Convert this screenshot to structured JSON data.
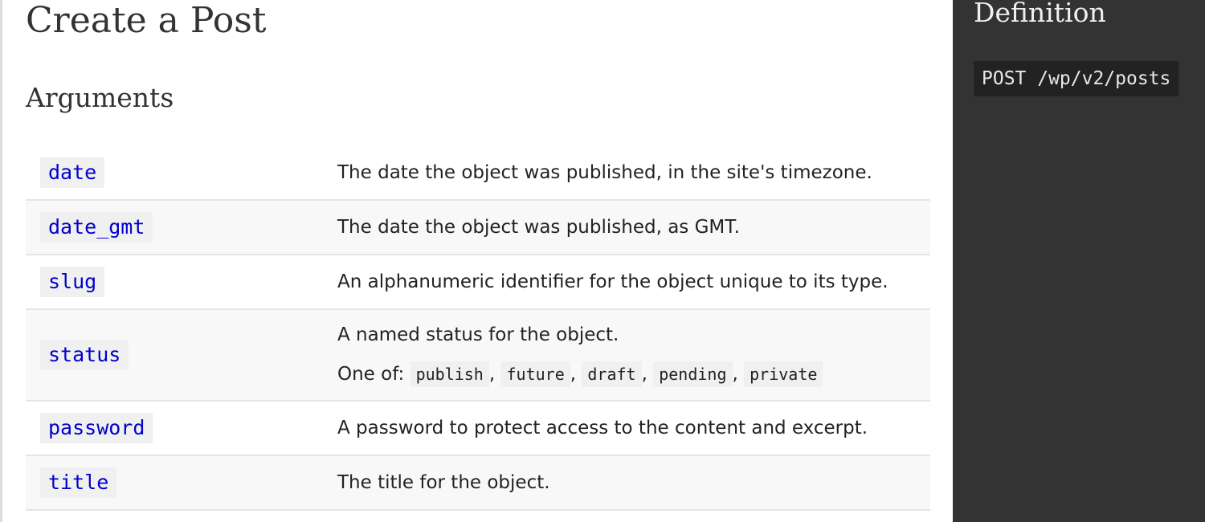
{
  "main": {
    "title": "Create a Post",
    "arguments_heading": "Arguments",
    "arguments": [
      {
        "name": "date",
        "description": "The date the object was published, in the site's timezone."
      },
      {
        "name": "date_gmt",
        "description": "The date the object was published, as GMT."
      },
      {
        "name": "slug",
        "description": "An alphanumeric identifier for the object unique to its type."
      },
      {
        "name": "status",
        "description": "A named status for the object.",
        "one_of_label": "One of:",
        "options": [
          "publish",
          "future",
          "draft",
          "pending",
          "private"
        ]
      },
      {
        "name": "password",
        "description": "A password to protect access to the content and excerpt."
      },
      {
        "name": "title",
        "description": "The title for the object."
      }
    ]
  },
  "sidebar": {
    "heading": "Definition",
    "endpoint": "POST /wp/v2/posts"
  },
  "colors": {
    "sidebar_background": "#333333",
    "code_link": "#0000cc",
    "code_background": "#f0f0f0"
  }
}
